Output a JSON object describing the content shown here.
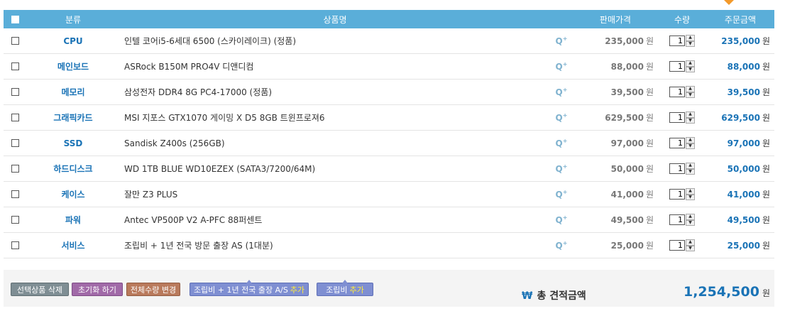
{
  "header": {
    "category": "분류",
    "product": "상품명",
    "price": "판매가격",
    "qty": "수량",
    "total": "주문금액"
  },
  "currency": "원",
  "zoom_icon": "zoom-plus-icon",
  "rows": [
    {
      "category": "CPU",
      "name": "인텔 코어i5-6세대 6500 (스카이레이크) (정품)",
      "price": "235,000",
      "qty": "1",
      "total": "235,000"
    },
    {
      "category": "메인보드",
      "name": "ASRock B150M PRO4V 디앤디컴",
      "price": "88,000",
      "qty": "1",
      "total": "88,000"
    },
    {
      "category": "메모리",
      "name": "삼성전자 DDR4 8G PC4-17000 (정품)",
      "price": "39,500",
      "qty": "1",
      "total": "39,500"
    },
    {
      "category": "그래픽카드",
      "name": "MSI 지포스 GTX1070 게이밍 X D5 8GB 트윈프로져6",
      "price": "629,500",
      "qty": "1",
      "total": "629,500"
    },
    {
      "category": "SSD",
      "name": "Sandisk Z400s (256GB)",
      "price": "97,000",
      "qty": "1",
      "total": "97,000"
    },
    {
      "category": "하드디스크",
      "name": "WD 1TB BLUE WD10EZEX (SATA3/7200/64M)",
      "price": "50,000",
      "qty": "1",
      "total": "50,000"
    },
    {
      "category": "케이스",
      "name": "잘만 Z3 PLUS",
      "price": "41,000",
      "qty": "1",
      "total": "41,000"
    },
    {
      "category": "파워",
      "name": "Antec VP500P V2 A-PFC 88퍼센트",
      "price": "49,500",
      "qty": "1",
      "total": "49,500"
    },
    {
      "category": "서비스",
      "name": "조립비 + 1년 전국 방문 출장 AS (1대분)",
      "price": "25,000",
      "qty": "1",
      "total": "25,000"
    }
  ],
  "footer": {
    "delete_selected": "선택상품 삭제",
    "reset": "초기화 하기",
    "change_all_qty": "전체수량 변경",
    "add_assembly_as": "조립비 + 1년 전국 출장 A/S",
    "add_assembly": "조립비",
    "add_word": "추가",
    "total_label": "총 견적금액",
    "total_value": "1,254,500",
    "won_symbol": "₩"
  },
  "colors": {
    "header_bg": "#5aaed9",
    "accent": "#1a73b6",
    "marker": "#f39a2b"
  }
}
